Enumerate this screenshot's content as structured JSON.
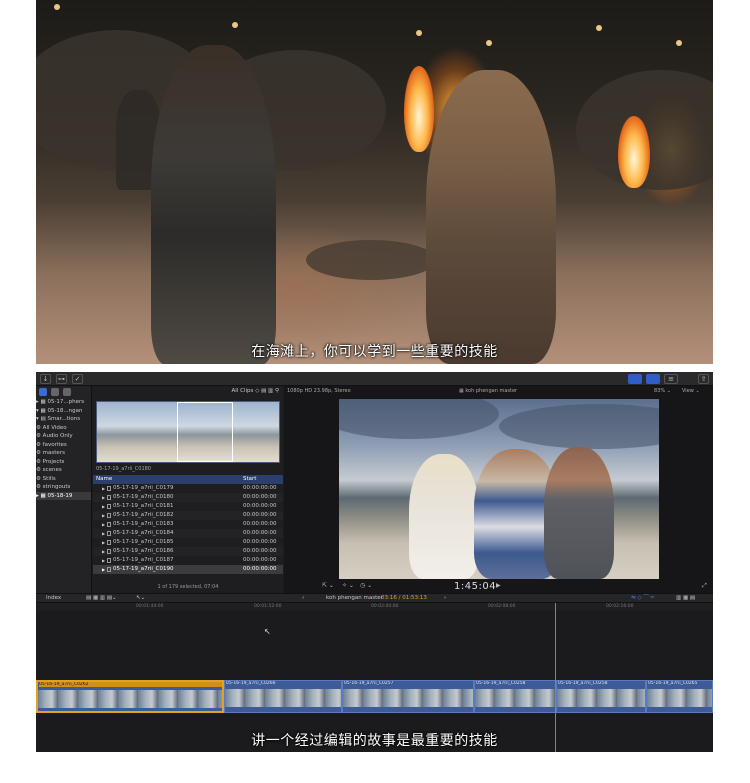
{
  "top_video": {
    "subtitle": "在海滩上，你可以学到一些重要的技能"
  },
  "editor": {
    "sidebar": {
      "items": [
        {
          "label": "▸ ▦ 05-17...phers"
        },
        {
          "label": "▾ ▦ 05-18...ngan"
        },
        {
          "label": "   ▾ ▤ Smar...tions"
        },
        {
          "label": "       ⚙ All Video"
        },
        {
          "label": "       ⚙ Audio Only"
        },
        {
          "label": "       ⚙ favorites"
        },
        {
          "label": "       ⚙ masters"
        },
        {
          "label": "       ⚙ Projects"
        },
        {
          "label": "       ⚙ scenes"
        },
        {
          "label": "       ⚙ Stills"
        },
        {
          "label": "       ⚙ stringouts"
        },
        {
          "label": "▸ ▦ 05-18-19"
        }
      ]
    },
    "browser": {
      "filter_label": "All Clips ◇  ▤  ▥  ⚲",
      "strip_label": "05-17-19_a7rii_C0180",
      "columns": {
        "name": "Name",
        "start": "Start"
      },
      "rows": [
        {
          "name": "05-17-19_a7rii_C0179",
          "start": "00:00:00:00"
        },
        {
          "name": "05-17-19_a7rii_C0180",
          "start": "00:00:00:00"
        },
        {
          "name": "05-17-19_a7rii_C0181",
          "start": "00:00:00:00"
        },
        {
          "name": "05-17-19_a7rii_C0182",
          "start": "00:00:00:00"
        },
        {
          "name": "05-17-19_a7rii_C0183",
          "start": "00:00:00:00"
        },
        {
          "name": "05-17-19_a7rii_C0184",
          "start": "00:00:00:00"
        },
        {
          "name": "05-17-19_a7rii_C0185",
          "start": "00:00:00:00"
        },
        {
          "name": "05-17-19_a7rii_C0186",
          "start": "00:00:00:00"
        },
        {
          "name": "05-17-19_a7rii_C0187",
          "start": "00:00:00:00"
        },
        {
          "name": "05-17-19_a7rii_C0190",
          "start": "00:00:00:00"
        }
      ],
      "footer": "1 of 179 selected, 07:04"
    },
    "viewer": {
      "format": "1080p HD 23.98p, Stereo",
      "project": "koh phengan master",
      "zoom": "83% ⌄",
      "view": "View ⌄",
      "timecode": "1:45:04"
    },
    "timeline_bar": {
      "index": "Index",
      "project": "koh phengan master",
      "duration": "03:16 / 01:53:13"
    },
    "ruler_ticks": [
      "00:01:44:00",
      "00:01:52:00",
      "00:02:00:00",
      "00:02:08:00",
      "00:02:16:00"
    ],
    "clips": [
      "05-16-19_a7rii_C0262",
      "05-16-19_a7rii_C0266",
      "05-16-19_a7rii_C0257",
      "05-16-19_a7rii_C0258",
      "05-16-19_a7rii_C0258",
      "05-16-19_a7rii_C0265"
    ],
    "subtitle": "讲一个经过编辑的故事是最重要的技能"
  }
}
